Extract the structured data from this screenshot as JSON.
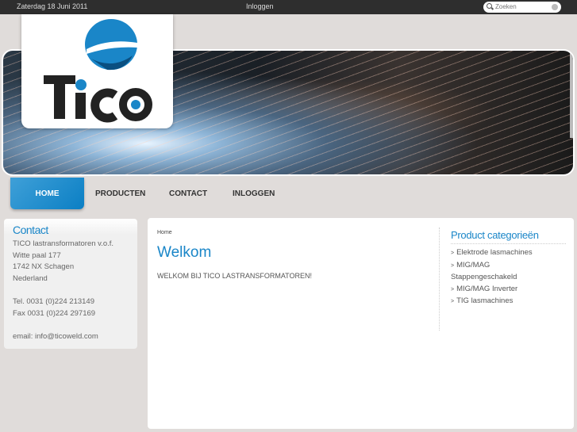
{
  "topbar": {
    "date": "Zaterdag 18 Juni 2011",
    "login": "Inloggen",
    "search_placeholder": "Zoeken"
  },
  "logo": {
    "text": "TICO"
  },
  "nav": [
    {
      "label": "HOME"
    },
    {
      "label": "PRODUCTEN"
    },
    {
      "label": "CONTACT"
    },
    {
      "label": "INLOGGEN"
    }
  ],
  "contact": {
    "title": "Contact",
    "lines": [
      "TICO lastransformatoren v.o.f.",
      "Witte paal 177",
      "1742 NX Schagen",
      "Nederland",
      "Tel. 0031 (0)224 213149",
      "Fax 0031 (0)224 297169",
      "email: info@ticoweld.com"
    ]
  },
  "main": {
    "breadcrumb": "Home",
    "title": "Welkom",
    "intro": "WELKOM BIJ TICO LASTRANSFORMATOREN!"
  },
  "categories": {
    "title": "Product categorieën",
    "arrow": ">",
    "items": [
      "Elektrode lasmachines",
      "MIG/MAG",
      "Stappengeschakeld",
      "MIG/MAG Inverter",
      "TIG lasmachines"
    ]
  },
  "colors": {
    "accent": "#1a86c8",
    "topbar": "#2e2e2e",
    "background": "#e0dcda"
  }
}
